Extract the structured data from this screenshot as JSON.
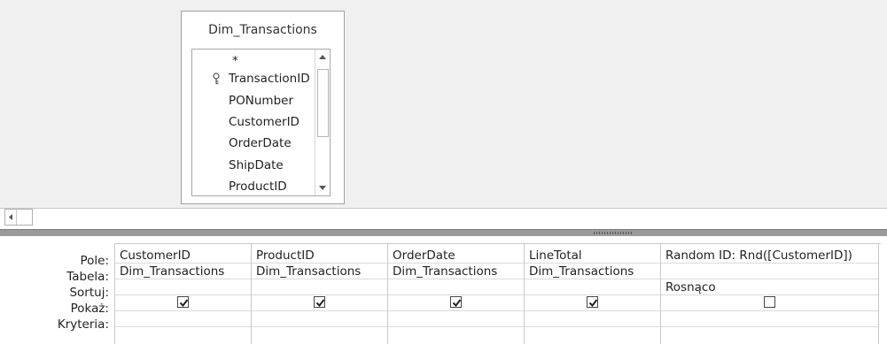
{
  "table": {
    "title": "Dim_Transactions",
    "fields": [
      {
        "label": "*",
        "is_key": false
      },
      {
        "label": "TransactionID",
        "is_key": true
      },
      {
        "label": "PONumber",
        "is_key": false
      },
      {
        "label": "CustomerID",
        "is_key": false
      },
      {
        "label": "OrderDate",
        "is_key": false
      },
      {
        "label": "ShipDate",
        "is_key": false
      },
      {
        "label": "ProductID",
        "is_key": false
      }
    ]
  },
  "grid": {
    "row_labels": {
      "field": "Pole:",
      "table": "Tabela:",
      "sort": "Sortuj:",
      "show": "Pokaż:",
      "criteria": "Kryteria:"
    },
    "columns": [
      {
        "field": "CustomerID",
        "table": "Dim_Transactions",
        "sort": "",
        "show": true,
        "criteria": ""
      },
      {
        "field": "ProductID",
        "table": "Dim_Transactions",
        "sort": "",
        "show": true,
        "criteria": ""
      },
      {
        "field": "OrderDate",
        "table": "Dim_Transactions",
        "sort": "",
        "show": true,
        "criteria": ""
      },
      {
        "field": "LineTotal",
        "table": "Dim_Transactions",
        "sort": "",
        "show": true,
        "criteria": ""
      },
      {
        "field": "Random ID: Rnd([CustomerID])",
        "table": "",
        "sort": "Rosnąco",
        "show": false,
        "criteria": ""
      }
    ]
  }
}
